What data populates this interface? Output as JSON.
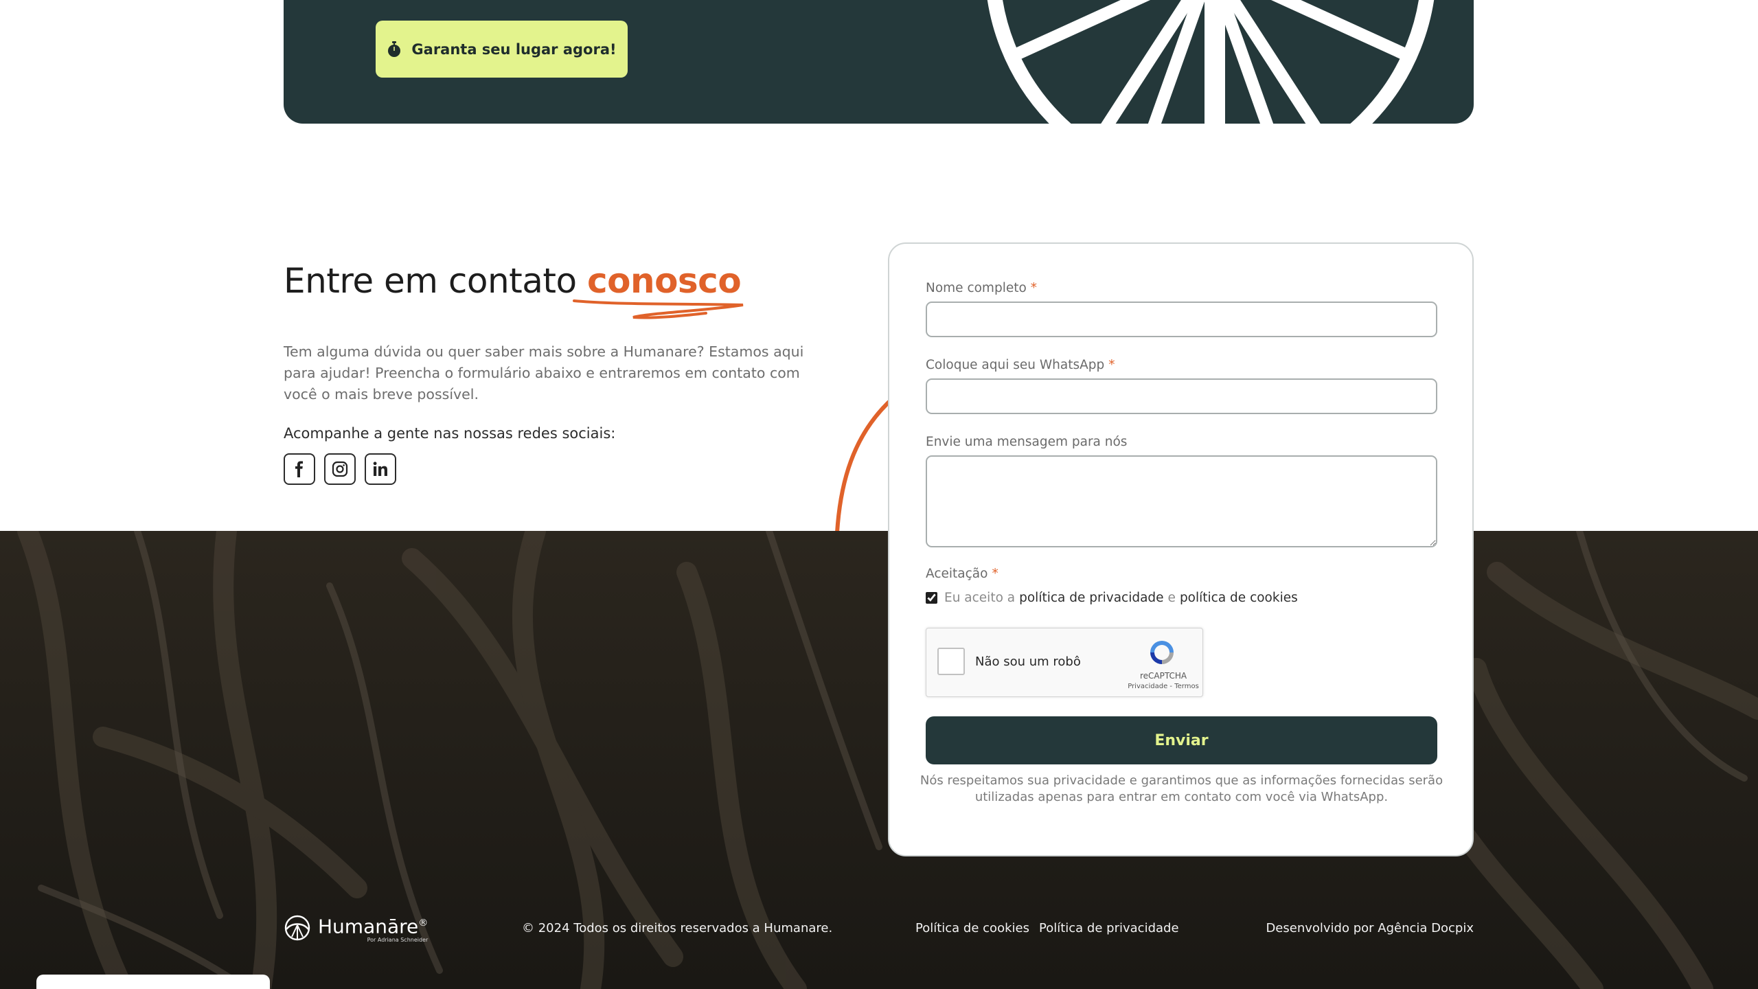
{
  "banner": {
    "cta_label": "Garanta seu lugar agora!"
  },
  "contact": {
    "heading": "Entre em contato",
    "heading_accent": "conosco",
    "intro": "Tem alguma dúvida ou quer saber mais sobre a Humanare? Estamos aqui para ajudar! Preencha o formulário abaixo e entraremos em contato com você o mais breve possível.",
    "social_title": "Acompanhe a gente nas nossas redes sociais:",
    "socials": [
      "facebook-icon",
      "instagram-icon",
      "linkedin-icon"
    ]
  },
  "form": {
    "name_label": "Nome completo",
    "name_value": "",
    "whatsapp_label": "Coloque aqui seu WhatsApp",
    "whatsapp_value": "",
    "message_label": "Envie uma mensagem para nós",
    "message_value": "",
    "required_mark": "*",
    "consent_label": "Aceitação",
    "consent_prefix": "Eu aceito a",
    "consent_link_privacy": "política de privacidade",
    "consent_and": "e",
    "consent_link_cookies": "política de cookies",
    "consent_checked": true,
    "captcha_label": "Não sou um robô",
    "captcha_brand": "reCAPTCHA",
    "captcha_terms": "Privacidade - Termos",
    "submit_label": "Enviar",
    "privacy_note": "Nós respeitamos sua privacidade e garantimos que as informações fornecidas serão utilizadas apenas para entrar em contato com você via WhatsApp."
  },
  "footer": {
    "brand": "Humanāre",
    "brand_mark": "®",
    "brand_sub": "Por Adriana Schneider",
    "copyright": "© 2024 Todos os direitos reservados a Humanare.",
    "cookies_link": "Política de cookies",
    "privacy_link": "Política de privacidade",
    "credit": "Desenvolvido por Agência Docpix"
  },
  "colors": {
    "banner_bg": "#24383a",
    "cta_bg": "#e3f38d",
    "accent_orange": "#e0622a",
    "footer_bg": "#1f1c17"
  }
}
